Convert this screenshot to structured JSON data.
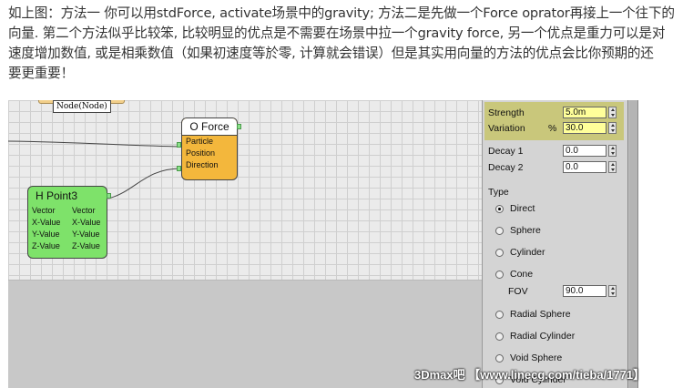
{
  "intro": {
    "line1": "如上图：方法一 你可以用stdForce, activate场景中的gravity; 方法二是先做一个Force oprator再接上一个往下的",
    "line2": "向量. 第二个方法似乎比较笨, 比较明显的优点是不需要在场景中拉一个gravity force, 另一个优点是重力可以是对",
    "line3": "速度增加数值, 或是相乘数值（如果初速度等於零, 计算就会错误）但是其实用向量的方法的优点会比你预期的还",
    "line4": "要更重要！"
  },
  "editor": {
    "node_tag": "Node(Node)",
    "oforce": {
      "title": "O Force",
      "ports": [
        "Particle",
        "Position",
        "Direction"
      ]
    },
    "hpoint": {
      "title": "H Point3",
      "inputs": [
        "Vector",
        "X-Value",
        "Y-Value",
        "Z-Value"
      ],
      "outputs": [
        "Vector",
        "X-Value",
        "Y-Value",
        "Z-Value"
      ]
    }
  },
  "panel": {
    "strength_label": "Strength",
    "strength_value": "5.0m",
    "variation_label": "Variation",
    "variation_unit": "%",
    "variation_value": "30.0",
    "decay1_label": "Decay 1",
    "decay1_value": "0.0",
    "decay2_label": "Decay 2",
    "decay2_value": "0.0",
    "type_label": "Type",
    "types": [
      "Direct",
      "Sphere",
      "Cylinder",
      "Cone",
      "Radial Sphere",
      "Radial Cylinder",
      "Void Sphere",
      "Void Cylinder"
    ],
    "selected_type": "Direct",
    "fov_label": "FOV",
    "fov_value": "90.0"
  },
  "watermark": "3Dmax吧 【www.linecg.com/tieba/1771】",
  "colors": {
    "oforce_node": "#f3b73c",
    "hpoint_node": "#7ee26a",
    "highlight": "#c9c77b",
    "active_field": "#ffff9a"
  }
}
